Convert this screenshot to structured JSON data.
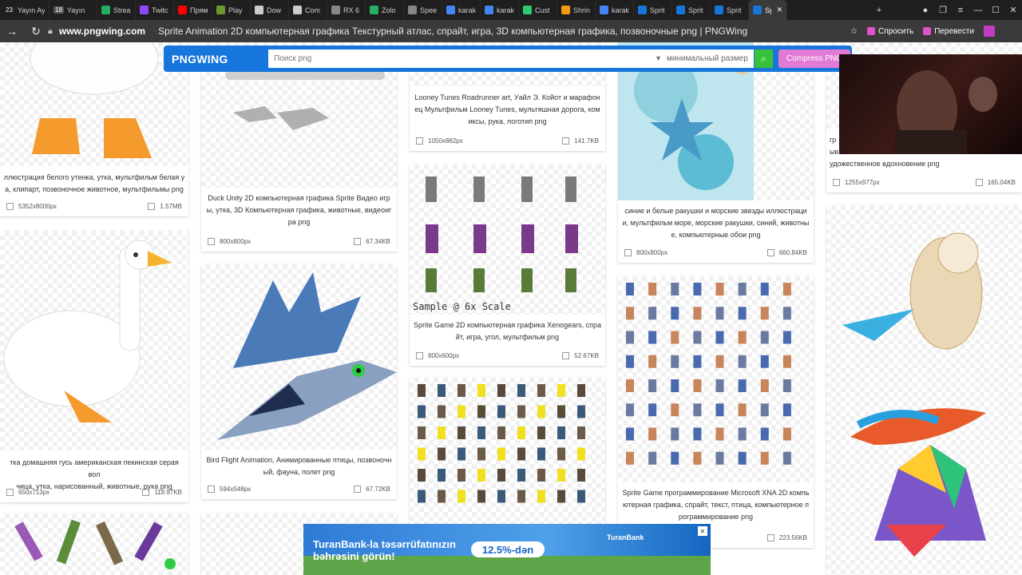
{
  "browser": {
    "tabs": [
      {
        "label": "Yayın Ayar",
        "color": "#c0392b",
        "prefix": "23"
      },
      {
        "label": "Yayın",
        "color": "#555555",
        "prefix": "18"
      },
      {
        "label": "Strea",
        "color": "#27ae60"
      },
      {
        "label": "Twitc",
        "color": "#9146ff"
      },
      {
        "label": "Прям",
        "color": "#ff0000"
      },
      {
        "label": "Play",
        "color": "#6a9a2e"
      },
      {
        "label": "Dow",
        "color": "#cccccc"
      },
      {
        "label": "Com",
        "color": "#cccccc"
      },
      {
        "label": "RX 6",
        "color": "#888888"
      },
      {
        "label": "Zolo",
        "color": "#27ae60"
      },
      {
        "label": "Spee",
        "color": "#888888"
      },
      {
        "label": "karak",
        "color": "#4285f4"
      },
      {
        "label": "karak",
        "color": "#4285f4"
      },
      {
        "label": "Cust",
        "color": "#2ecc71"
      },
      {
        "label": "Shrin",
        "color": "#f39c12"
      },
      {
        "label": "karak",
        "color": "#4285f4"
      },
      {
        "label": "Sprit",
        "color": "#1676db"
      },
      {
        "label": "Sprit",
        "color": "#1676db"
      },
      {
        "label": "Sprit",
        "color": "#1676db"
      },
      {
        "label": "Sp",
        "color": "#1676db",
        "active": true
      }
    ],
    "url_host": "www.pngwing.com",
    "page_title": "Sprite Animation 2D компьютерная графика Текстурный атлас, спрайт, игра, 3D компьютерная графика, позвоночные png | PNGWing",
    "ask_label": "Спросить",
    "translate_label": "Перевести"
  },
  "site": {
    "logo": "PNGWING",
    "search_placeholder": "Поиск png",
    "size_label": "минимальный размер",
    "compress_label": "Compress PNG"
  },
  "cards": [
    {
      "caption": "ллюстрация белого утенка, утка, мультфильм белая у\nа, клипарт, позвоночное животное, мультфильмы png",
      "dims": "5352x8000px",
      "size": "1.57MB"
    },
    {
      "caption": "Duck Unity 2D компьютерная графика Sprite Видео игр\nы, утка, 3D Компьютерная графика, животные, видеоиг\nра png",
      "dims": "800x800px",
      "size": "67.34KB"
    },
    {
      "caption": "Looney Tunes Roadrunner art, Уайл Э. Койот и марафон\nец Мультфильм Looney Tunes, мультяшная дорога, ком\nиксы, рука, логотип png",
      "dims": "1050x882px",
      "size": "141.7KB"
    },
    {
      "caption": "синие и белые ракушки и морские звезды иллюстраци\nи, мультфильм море, морские ракушки, синий, животны\nе, компьютерные обои png",
      "dims": "800x800px",
      "size": "660.84KB"
    },
    {
      "caption": "гр\nыв\nудожественное вдохновение png",
      "dims": "1255x977px",
      "size": "165.04KB"
    },
    {
      "caption": "тка домашняя гусь американская пекинская серая вол\nчица, утка, нарисованный, животные, рука png",
      "dims": "650x713px",
      "size": "118.97KB"
    },
    {
      "caption": "Bird Flight Animation, Анимированные птицы, позвоночн\nый, фауна, полет png",
      "dims": "594x548px",
      "size": "67.72KB"
    },
    {
      "caption": "Sprite Game 2D компьютерная графика Xenogears, спра\nйт, игра, угол, мультфильм png",
      "dims": "800x600px",
      "size": "52.67KB"
    },
    {
      "caption": "Sprite Game программирование Microsoft XNA 2D компь\nютерная графика, спрайт, текст, птица, компьютерное п\nрограммирование png",
      "dims": "",
      "size": "223.56KB"
    }
  ],
  "sprite_sample_text": "Sample @ 6x Scale",
  "ad": {
    "headline": "TuranBank-la təsərrüfatınızın\nbəhrəsini görün!",
    "rate": "12.5%-dən",
    "brand": "TuranBank"
  },
  "colors": {
    "brand": "#1676db",
    "search_button": "#3ac13a",
    "compress": "#e27bd5"
  }
}
